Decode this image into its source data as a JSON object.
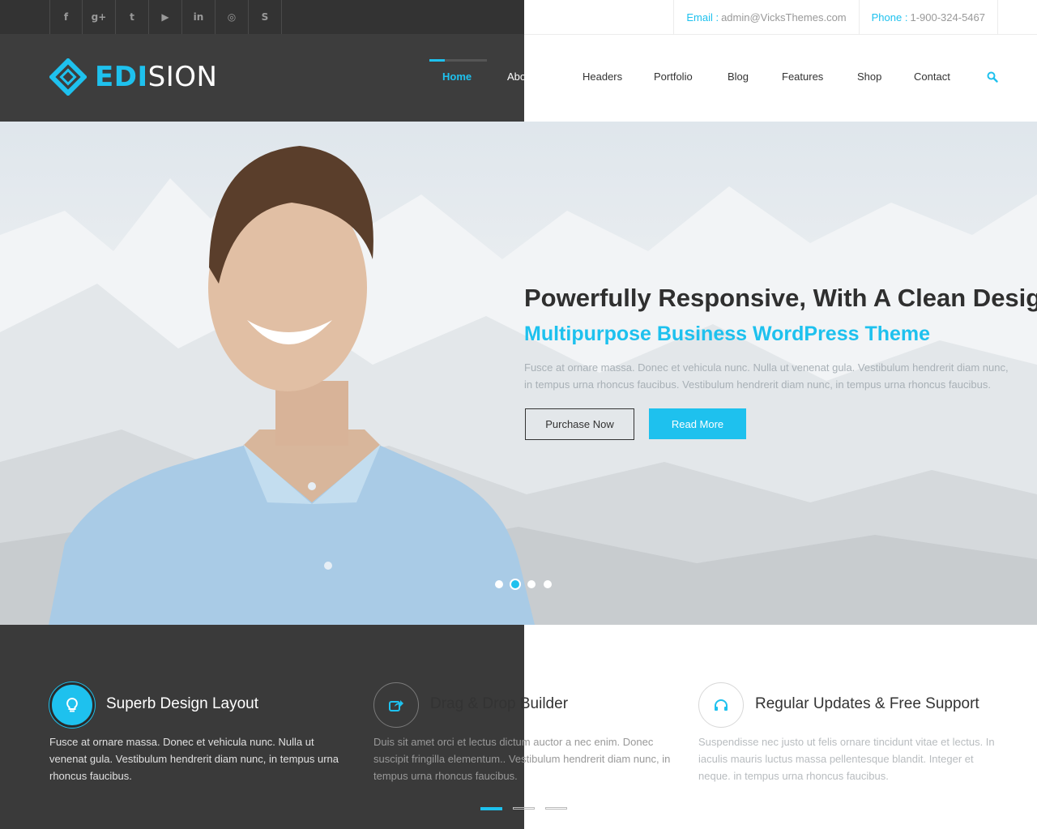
{
  "colors": {
    "accent": "#1ec1ee",
    "dark": "#3d3d3d",
    "text": "#333333"
  },
  "topbar": {
    "socials": [
      {
        "icon": "facebook-icon",
        "glyph": "f"
      },
      {
        "icon": "google-plus-icon",
        "glyph": "g+"
      },
      {
        "icon": "twitter-icon",
        "glyph": "t"
      },
      {
        "icon": "youtube-icon",
        "glyph": "▶"
      },
      {
        "icon": "linkedin-icon",
        "glyph": "in"
      },
      {
        "icon": "dribbble-icon",
        "glyph": "◎"
      },
      {
        "icon": "skype-icon",
        "glyph": "S"
      }
    ],
    "email_label": "Email :",
    "email_value": "admin@VicksThemes.com",
    "phone_label": "Phone :",
    "phone_value": "1-900-324-5467"
  },
  "logo": {
    "part1": "EDI",
    "part2": "SION"
  },
  "nav": {
    "items": [
      "Home",
      "About us",
      "Headers",
      "Portfolio",
      "Blog",
      "Features",
      "Shop",
      "Contact"
    ],
    "active": "Home",
    "search_icon": "search-icon"
  },
  "hero": {
    "title": "Powerfully Responsive, With A Clean Design",
    "subtitle": "Multipurpose Business WordPress Theme",
    "text": "Fusce at ornare massa. Donec et vehicula nunc. Nulla ut venenat gula. Vestibulum hendrerit diam nunc, in tempus urna rhoncus faucibus. Vestibulum hendrerit diam nunc, in tempus urna rhoncus faucibus.",
    "btn_purchase": "Purchase Now",
    "btn_read": "Read More",
    "slide_count": 4,
    "active_slide": 2
  },
  "features": [
    {
      "icon": "lightbulb-icon",
      "title": "Superb Design Layout",
      "text": "Fusce at ornare massa. Donec et vehicula nunc. Nulla ut venenat gula. Vestibulum hendrerit diam nunc, in tempus urna rhoncus faucibus."
    },
    {
      "icon": "share-icon",
      "title": "Drag & Drop Builder",
      "text": "Duis sit amet orci et lectus dictum auctor a nec enim. Donec suscipit fringilla elementum.. Vestibulum hendrerit diam nunc, in tempus urna rhoncus faucibus."
    },
    {
      "icon": "headphones-icon",
      "title": "Regular Updates & Free Support",
      "text": "Suspendisse nec justo ut felis ornare tincidunt vitae et lectus. In iaculis mauris luctus massa pellentesque blandit. Integer et neque. in tempus urna rhoncus faucibus."
    }
  ],
  "features_pager": {
    "page_count": 3,
    "active_page": 1
  }
}
